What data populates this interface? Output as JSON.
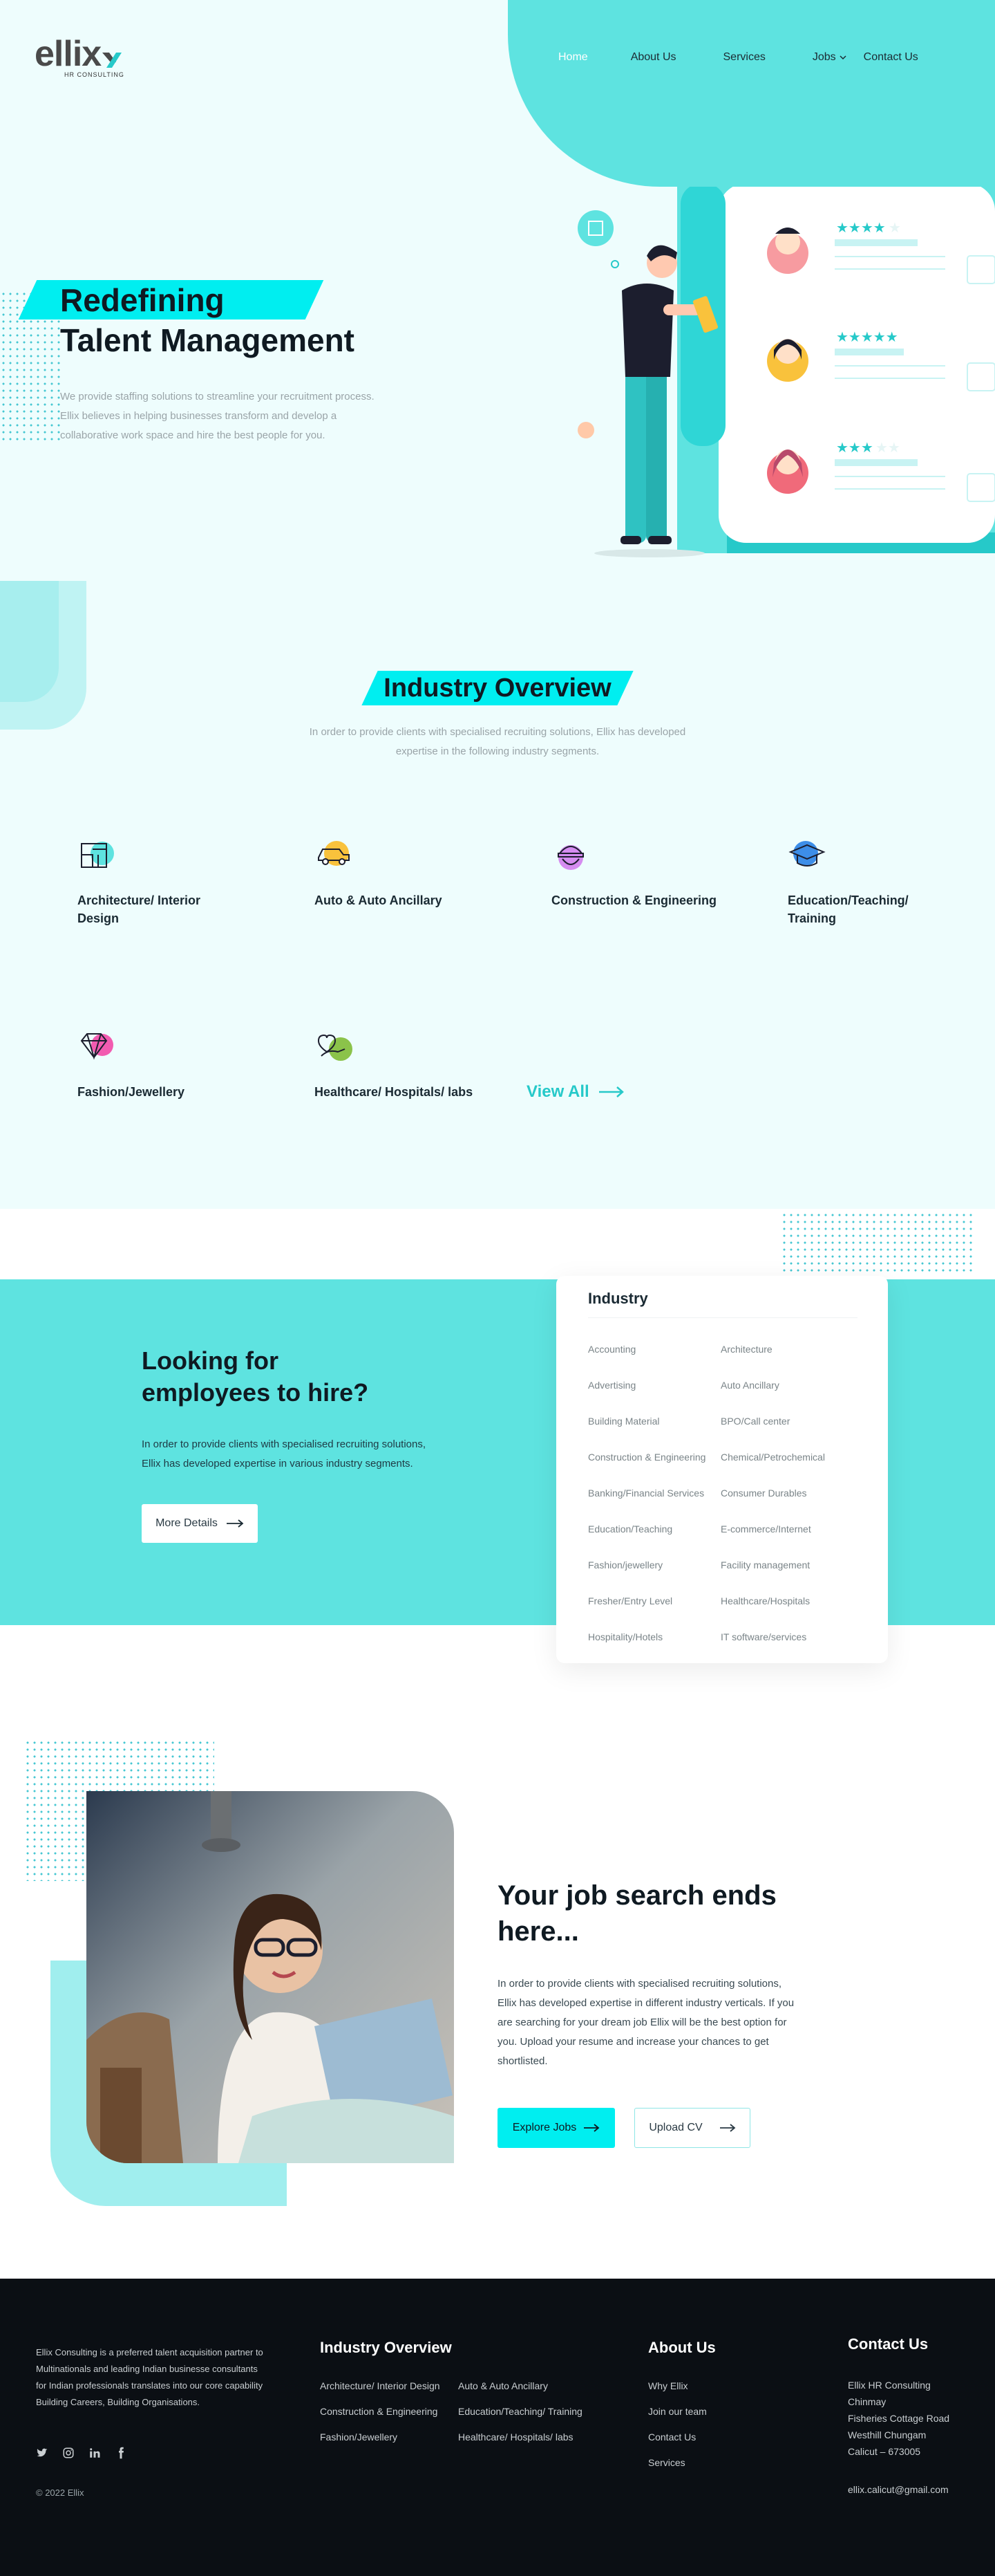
{
  "brand": {
    "logo": "ellix",
    "tagline": "HR CONSULTING"
  },
  "nav": {
    "items": [
      {
        "label": "Home",
        "active": true
      },
      {
        "label": "About Us"
      },
      {
        "label": "Services"
      },
      {
        "label": "Jobs",
        "dropdown": true
      },
      {
        "label": "Contact Us"
      }
    ]
  },
  "hero": {
    "title_line1": "Redefining",
    "title_line2": "Talent Management",
    "description": "We provide staffing solutions to streamline your recruitment process. Ellix believes in helping businesses transform and develop a collaborative work space and hire the best people for you.",
    "ratings": [
      4,
      5,
      3
    ]
  },
  "industry": {
    "title": "Industry Overview",
    "description": "In order to provide clients with specialised recruiting solutions, Ellix has developed expertise in the following industry segments.",
    "items": [
      {
        "label": "Architecture/ Interior Design",
        "icon": "blueprint-icon"
      },
      {
        "label": "Auto & Auto Ancillary",
        "icon": "car-icon"
      },
      {
        "label": "Construction & Engineering",
        "icon": "construction-helmet-icon"
      },
      {
        "label": "Education/Teaching/ Training",
        "icon": "graduation-cap-icon"
      },
      {
        "label": "Fashion/Jewellery",
        "icon": "diamond-icon"
      },
      {
        "label": "Healthcare/ Hospitals/ labs",
        "icon": "heart-hand-icon"
      }
    ],
    "view_all": "View All"
  },
  "hire": {
    "title_line1": "Looking for",
    "title_line2": "employees to hire?",
    "description": "In order to provide clients with specialised recruiting solutions, Ellix has developed expertise in various industry segments.",
    "button": "More Details",
    "card_title": "Industry",
    "card_items": [
      "Accounting",
      "Architecture",
      "Advertising",
      "Auto Ancillary",
      "Building Material",
      "BPO/Call center",
      "Construction & Engineering",
      "Chemical/Petrochemical",
      "Banking/Financial Services",
      "Consumer Durables",
      "Education/Teaching",
      "E-commerce/Internet",
      "Fashion/jewellery",
      "Facility management",
      "Fresher/Entry Level",
      "Healthcare/Hospitals",
      "Hospitality/Hotels",
      "IT software/services"
    ]
  },
  "jobsearch": {
    "title": "Your job search ends here...",
    "description": "In order to provide clients with specialised recruiting solutions, Ellix has developed expertise in different industry verticals. If you are searching for your dream job Ellix will be the best option for you. Upload your resume and increase your chances to get shortlisted.",
    "btn_explore": "Explore Jobs",
    "btn_upload": "Upload CV"
  },
  "footer": {
    "about": "Ellix Consulting is a preferred talent acquisition partner to Multinationals and leading Indian businesse consultants for Indian professionals translates into our core capability Building Careers, Building Organisations.",
    "copyright": "© 2022 Ellix",
    "industry_title": "Industry Overview",
    "industry_col1": [
      "Architecture/ Interior Design",
      "Construction & Engineering",
      "Fashion/Jewellery"
    ],
    "industry_col2": [
      "Auto & Auto Ancillary",
      "Education/Teaching/ Training",
      "Healthcare/ Hospitals/ labs"
    ],
    "about_title": "About Us",
    "about_links": [
      "Why Ellix",
      "Join our team",
      "Contact Us",
      "Services"
    ],
    "contact_title": "Contact Us",
    "address": [
      "Ellix HR Consulting",
      "Chinmay",
      "Fisheries Cottage Road",
      "Westhill Chungam",
      "Calicut – 673005"
    ],
    "email": "ellix.calicut@gmail.com"
  },
  "colors": {
    "accent": "#00eef0",
    "teal": "#5ee3e0",
    "dark": "#0b0f14",
    "bg": "#eefdfd"
  }
}
